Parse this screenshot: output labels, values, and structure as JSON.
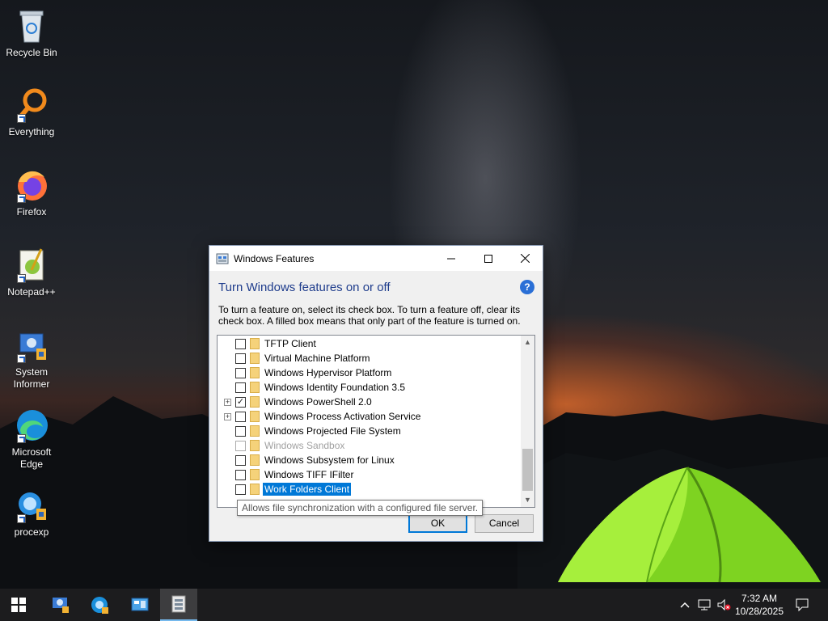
{
  "desktop": {
    "icons": [
      {
        "label": "Recycle Bin",
        "icon": "recycle-bin-icon"
      },
      {
        "label": "Everything",
        "icon": "everything-search-icon"
      },
      {
        "label": "Firefox",
        "icon": "firefox-icon"
      },
      {
        "label": "Notepad++",
        "icon": "notepad-plus-plus-icon"
      },
      {
        "label": "System Informer",
        "icon": "system-informer-icon"
      },
      {
        "label": "Microsoft Edge",
        "icon": "edge-icon"
      },
      {
        "label": "procexp",
        "icon": "procexp-icon"
      }
    ]
  },
  "dialog": {
    "title": "Windows Features",
    "heading": "Turn Windows features on or off",
    "description": "To turn a feature on, select its check box. To turn a feature off, clear its check box. A filled box means that only part of the feature is turned on.",
    "features": [
      {
        "label": "TFTP Client",
        "checked": false,
        "expandable": false,
        "disabled": false,
        "selected": false
      },
      {
        "label": "Virtual Machine Platform",
        "checked": false,
        "expandable": false,
        "disabled": false,
        "selected": false
      },
      {
        "label": "Windows Hypervisor Platform",
        "checked": false,
        "expandable": false,
        "disabled": false,
        "selected": false
      },
      {
        "label": "Windows Identity Foundation 3.5",
        "checked": false,
        "expandable": false,
        "disabled": false,
        "selected": false
      },
      {
        "label": "Windows PowerShell 2.0",
        "checked": true,
        "expandable": true,
        "disabled": false,
        "selected": false
      },
      {
        "label": "Windows Process Activation Service",
        "checked": false,
        "expandable": true,
        "disabled": false,
        "selected": false
      },
      {
        "label": "Windows Projected File System",
        "checked": false,
        "expandable": false,
        "disabled": false,
        "selected": false
      },
      {
        "label": "Windows Sandbox",
        "checked": false,
        "expandable": false,
        "disabled": true,
        "selected": false
      },
      {
        "label": "Windows Subsystem for Linux",
        "checked": false,
        "expandable": false,
        "disabled": false,
        "selected": false
      },
      {
        "label": "Windows TIFF IFilter",
        "checked": false,
        "expandable": false,
        "disabled": false,
        "selected": false
      },
      {
        "label": "Work Folders Client",
        "checked": false,
        "expandable": false,
        "disabled": false,
        "selected": true
      }
    ],
    "tooltip": "Allows file synchronization with a configured file server.",
    "ok_label": "OK",
    "cancel_label": "Cancel",
    "help_label": "?"
  },
  "taskbar": {
    "items": [
      {
        "icon": "start-windows-icon"
      },
      {
        "icon": "system-informer-icon"
      },
      {
        "icon": "edge-icon"
      },
      {
        "icon": "control-panel-icon"
      },
      {
        "icon": "windows-features-icon",
        "active": true
      }
    ],
    "tray": {
      "time": "7:32 AM",
      "date": "10/28/2025",
      "icons": [
        "chevron-up-icon",
        "network-icon",
        "volume-muted-icon",
        "notification-icon"
      ]
    }
  }
}
